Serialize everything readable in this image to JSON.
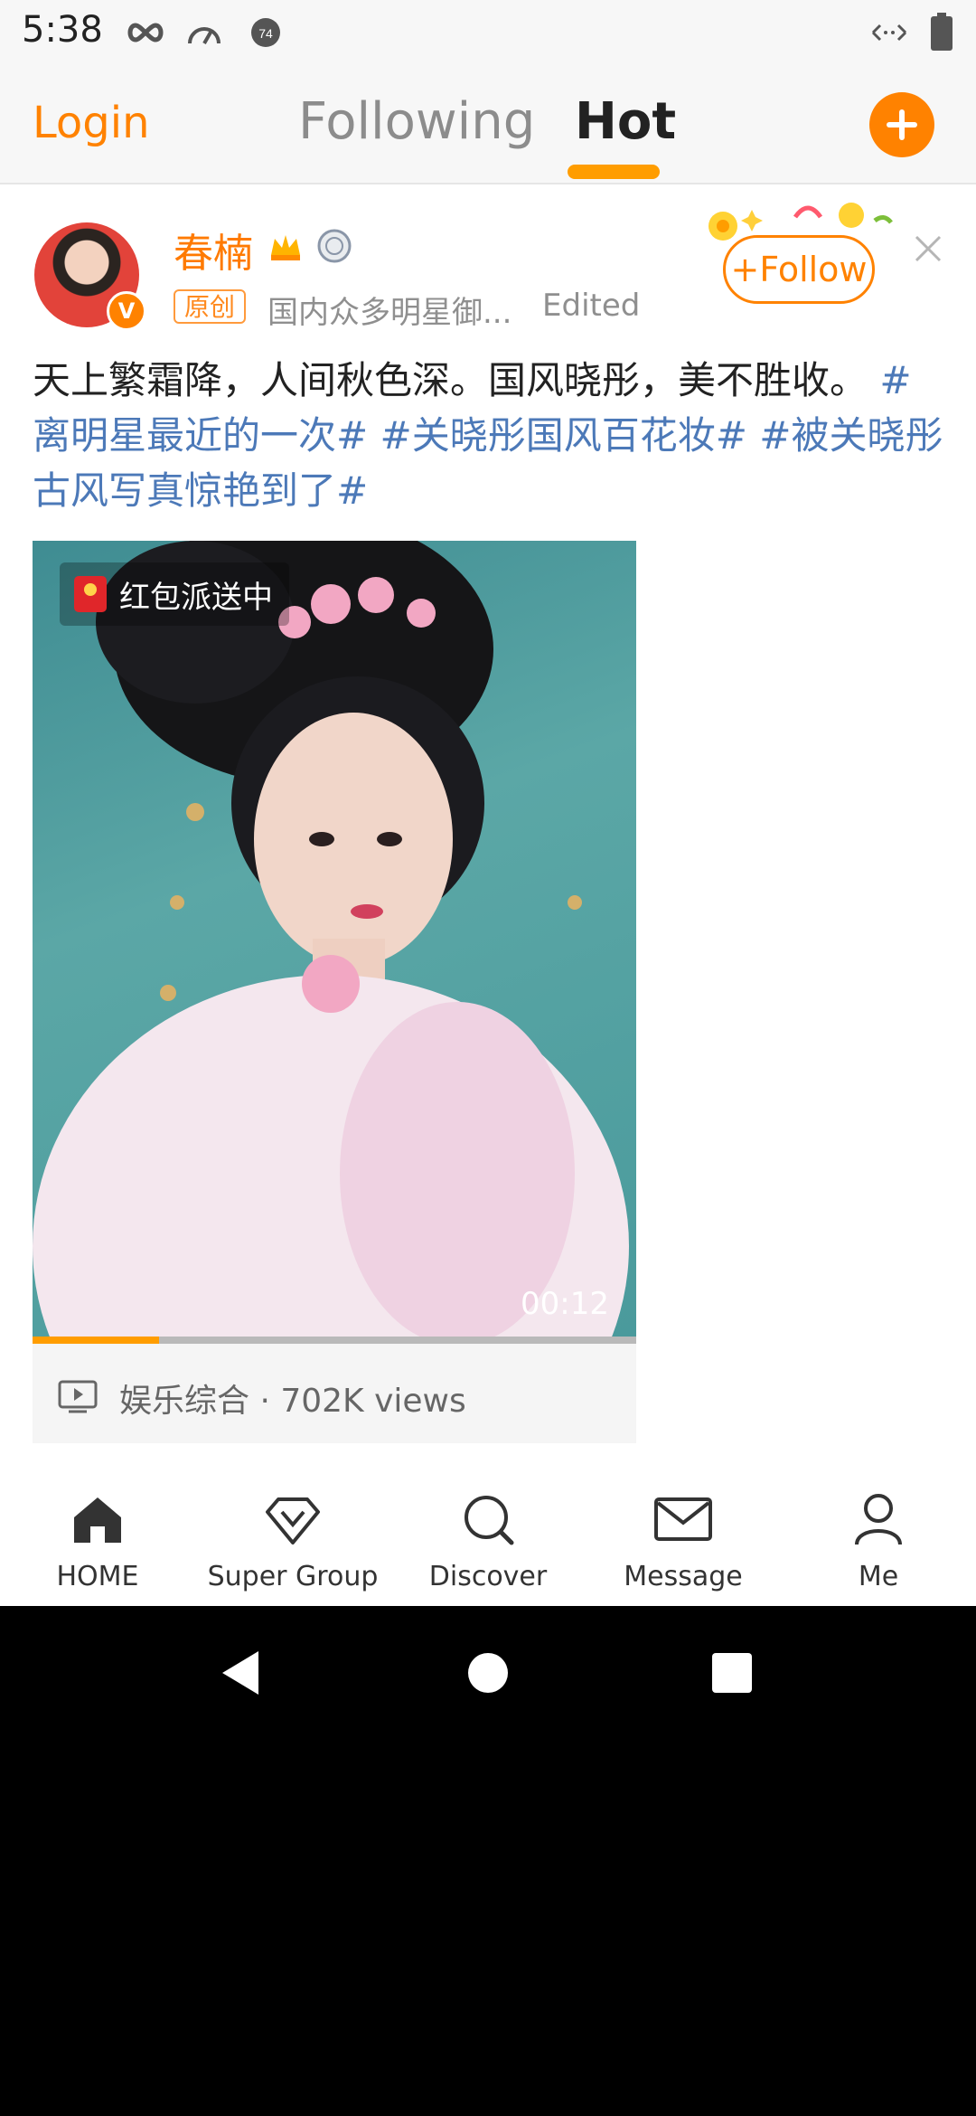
{
  "status_bar": {
    "time": "5:38",
    "icons": [
      "infinity-icon",
      "speedometer-icon",
      "notification-74-icon"
    ],
    "right_icons": [
      "data-arrows-icon",
      "battery-icon"
    ]
  },
  "header": {
    "login": "Login",
    "tabs": [
      {
        "label": "Following",
        "active": false
      },
      {
        "label": "Hot",
        "active": true
      }
    ],
    "compose_icon": "plus-icon",
    "accent": "#ff8200"
  },
  "post": {
    "username": "春楠",
    "badges": [
      "crown-icon",
      "medal-icon"
    ],
    "original_tag": "原创",
    "source": "国内众多明星御...",
    "edited": "Edited",
    "follow_label": "Follow",
    "text": "天上繁霜降，人间秋色深。国风晓彤，美不胜收。",
    "hashtags": "#离明星最近的一次# #关晓彤国风百花妆# #被关晓彤古风写真惊艳到了#",
    "video": {
      "badge": "红包派送中",
      "duration": "00:12",
      "progress": 0.21
    },
    "video_meta": "娱乐综合 · 702K views"
  },
  "bottom_nav": {
    "items": [
      {
        "label": "HOME",
        "icon": "home-icon"
      },
      {
        "label": "Super Group",
        "icon": "diamond-icon"
      },
      {
        "label": "Discover",
        "icon": "search-icon"
      },
      {
        "label": "Message",
        "icon": "envelope-icon"
      },
      {
        "label": "Me",
        "icon": "person-icon"
      }
    ]
  },
  "system_nav": [
    "back-icon",
    "home-circle-icon",
    "recents-icon"
  ]
}
